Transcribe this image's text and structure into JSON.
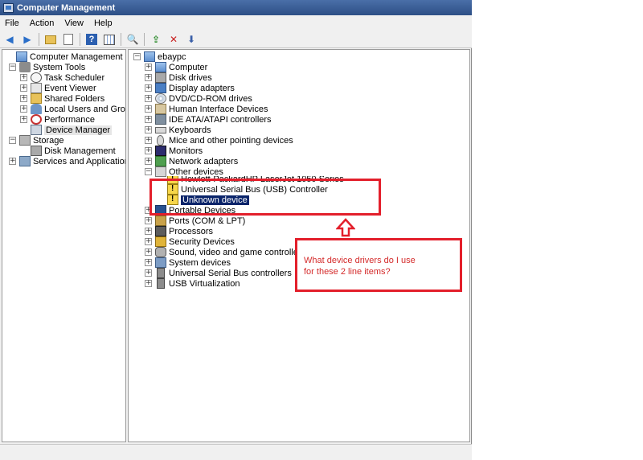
{
  "window": {
    "title": "Computer Management"
  },
  "menu": [
    "File",
    "Action",
    "View",
    "Help"
  ],
  "toolbar": {
    "icons": [
      "back-arrow-icon",
      "forward-arrow-icon",
      "up-folder-icon",
      "properties-icon",
      "help-icon",
      "show-hide-icon",
      "scan-icon",
      "update-driver-icon",
      "uninstall-icon",
      "disable-icon"
    ]
  },
  "left_tree": {
    "root": "Computer Management (Local)",
    "system_tools": "System Tools",
    "task_scheduler": "Task Scheduler",
    "event_viewer": "Event Viewer",
    "shared_folders": "Shared Folders",
    "local_users": "Local Users and Groups",
    "performance": "Performance",
    "device_manager": "Device Manager",
    "storage": "Storage",
    "disk_management": "Disk Management",
    "services": "Services and Applications"
  },
  "right_tree": {
    "root": "ebaypc",
    "computer": "Computer",
    "disk_drives": "Disk drives",
    "display_adapters": "Display adapters",
    "dvd": "DVD/CD-ROM drives",
    "hid": "Human Interface Devices",
    "ide": "IDE ATA/ATAPI controllers",
    "keyboards": "Keyboards",
    "mice": "Mice and other pointing devices",
    "monitors": "Monitors",
    "network": "Network adapters",
    "other_devices": "Other devices",
    "other_printer": "Hewlett-PackardHP LaserJet 1050 Series",
    "other_usb": "Universal Serial Bus (USB) Controller",
    "other_unknown": "Unknown device",
    "portable": "Portable Devices",
    "ports": "Ports (COM & LPT)",
    "processors": "Processors",
    "security": "Security Devices",
    "sound": "Sound, video and game controllers",
    "system_devices": "System devices",
    "usb_controllers": "Universal Serial Bus controllers",
    "usb_virtualization": "USB Virtualization"
  },
  "annotation": {
    "text": "What device drivers do I use\nfor these 2 line items?",
    "color": "#e31f2b"
  }
}
